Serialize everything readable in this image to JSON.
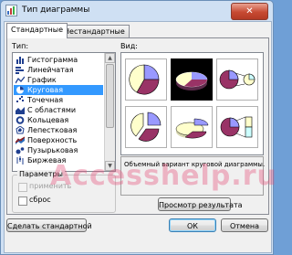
{
  "window": {
    "title": "Тип диаграммы",
    "close_label": "✕"
  },
  "tabs": [
    {
      "label": "Стандартные",
      "active": true
    },
    {
      "label": "Нестандартные",
      "active": false
    }
  ],
  "left": {
    "type_label": "Тип:",
    "chart_types": [
      {
        "label": "Гистограмма",
        "icon": "column-chart-icon"
      },
      {
        "label": "Линейчатая",
        "icon": "bar-chart-icon"
      },
      {
        "label": "График",
        "icon": "line-chart-icon"
      },
      {
        "label": "Круговая",
        "icon": "pie-chart-icon",
        "selected": true
      },
      {
        "label": "Точечная",
        "icon": "scatter-chart-icon"
      },
      {
        "label": "С областями",
        "icon": "area-chart-icon"
      },
      {
        "label": "Кольцевая",
        "icon": "doughnut-chart-icon"
      },
      {
        "label": "Лепестковая",
        "icon": "radar-chart-icon"
      },
      {
        "label": "Поверхность",
        "icon": "surface-chart-icon"
      },
      {
        "label": "Пузырьковая",
        "icon": "bubble-chart-icon"
      },
      {
        "label": "Биржевая",
        "icon": "stock-chart-icon"
      }
    ]
  },
  "right": {
    "view_label": "Вид:",
    "description": "Объемный вариант круговой диаграммы.",
    "preview_button": "Просмотр результата"
  },
  "params": {
    "title": "Параметры",
    "apply_label": "применить",
    "reset_label": "сброс"
  },
  "footer": {
    "set_default_button": "Сделать стандартной",
    "ok_button": "ОК",
    "cancel_button": "Отмена"
  },
  "watermark": "Accesshelp.ru",
  "colors": {
    "pie_a": "#9999ff",
    "pie_b": "#993366",
    "pie_c": "#ffffcc",
    "pie_d": "#ccffff",
    "selection": "#3399ff"
  }
}
